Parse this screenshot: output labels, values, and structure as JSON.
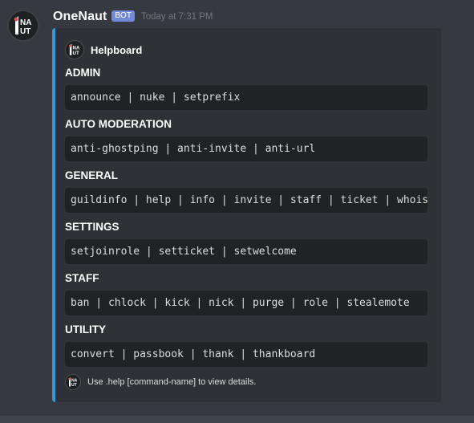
{
  "message": {
    "username": "OneNaut",
    "bot_badge": "BOT",
    "timestamp": "Today at 7:31 PM",
    "avatar_icon": "onenaut-logo-icon"
  },
  "embed": {
    "accent_color": "#3498db",
    "author": {
      "name": "Helpboard",
      "icon": "onenaut-logo-icon"
    },
    "fields": [
      {
        "name": "ADMIN",
        "value": "announce | nuke | setprefix"
      },
      {
        "name": "AUTO MODERATION",
        "value": "anti-ghostping | anti-invite | anti-url"
      },
      {
        "name": "GENERAL",
        "value": "guildinfo | help | info | invite | staff | ticket | whois"
      },
      {
        "name": "SETTINGS",
        "value": "setjoinrole | setticket | setwelcome"
      },
      {
        "name": "STAFF",
        "value": "ban | chlock | kick | nick | purge | role | stealemote"
      },
      {
        "name": "UTILITY",
        "value": "convert | passbook | thank | thankboard"
      }
    ],
    "footer": {
      "text": "Use .help [command-name] to view details.",
      "icon": "onenaut-logo-icon"
    }
  },
  "colors": {
    "background": "#36393f",
    "embed_background": "#2f3136",
    "code_background": "#202225",
    "bot_badge": "#7289da"
  }
}
